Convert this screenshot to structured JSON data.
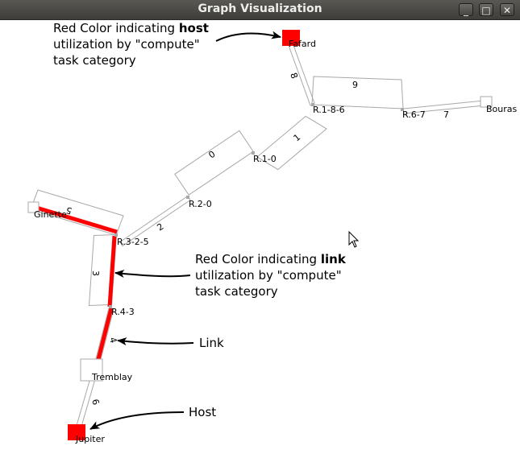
{
  "window": {
    "title": "Graph Visualization",
    "controls": {
      "minimize": "_",
      "maximize": "□",
      "close": "✕"
    }
  },
  "graph": {
    "hosts": {
      "fafard": "Fafard",
      "bouras": "Bouras",
      "ginette": "Ginette",
      "tremblay": "Tremblay",
      "jupiter": "Jupiter"
    },
    "routers": {
      "r18": "R.1-8-6",
      "r67": "R.6-7",
      "r10": "R.1-0",
      "r20": "R.2-0",
      "r325": "R.3-2-5",
      "r43": "R.4-3"
    },
    "links": {
      "l0": "0",
      "l1": "1",
      "l2": "2",
      "l3": "3",
      "l4": "4",
      "l5": "5",
      "l6": "6",
      "l7": "7",
      "l8": "8",
      "l9": "9"
    },
    "colors": {
      "utilization": "#ff0000",
      "outline": "#a8a8a8"
    }
  },
  "annotations": {
    "host_note": {
      "line1_prefix": "Red Color indicating ",
      "line1_bold": "host",
      "line2": "utilization by \"compute\"",
      "line3": "task category"
    },
    "link_note": {
      "line1_prefix": "Red Color indicating ",
      "line1_bold": "link",
      "line2": "utilization by \"compute\"",
      "line3": "task category"
    },
    "link_label": "Link",
    "host_label": "Host"
  }
}
